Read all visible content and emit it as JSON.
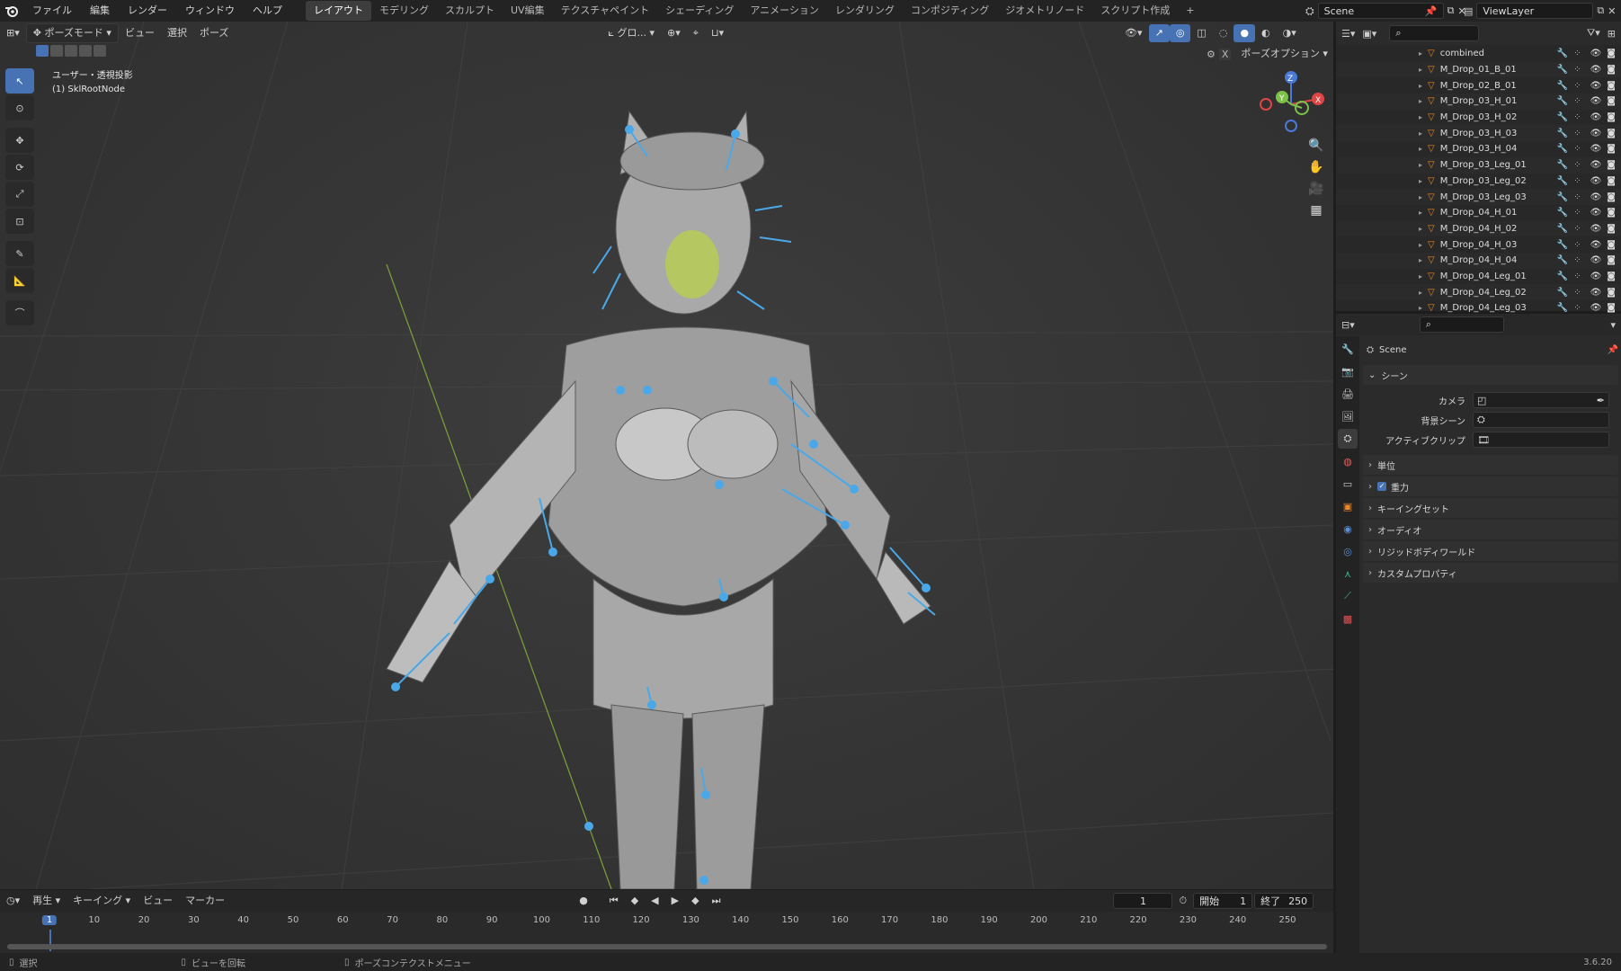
{
  "topbar": {
    "menus": [
      "ファイル",
      "編集",
      "レンダー",
      "ウィンドウ",
      "ヘルプ"
    ],
    "workspaces": [
      "レイアウト",
      "モデリング",
      "スカルプト",
      "UV編集",
      "テクスチャペイント",
      "シェーディング",
      "アニメーション",
      "レンダリング",
      "コンポジティング",
      "ジオメトリノード",
      "スクリプト作成"
    ],
    "add_tab": "+",
    "scene_name": "Scene",
    "view_layer": "ViewLayer"
  },
  "viewport": {
    "mode": "ポーズモード",
    "menus": [
      "ビュー",
      "選択",
      "ポーズ"
    ],
    "transform_orient": "グロ...",
    "pose_options": "ポーズオプション",
    "overlay_title": "ユーザー・透視投影",
    "overlay_object": "(1) SklRootNode",
    "gizmo": {
      "z": "Z",
      "y": "Y",
      "x": "X"
    }
  },
  "outliner": {
    "items": [
      {
        "name": "combined"
      },
      {
        "name": "M_Drop_01_B_01"
      },
      {
        "name": "M_Drop_02_B_01"
      },
      {
        "name": "M_Drop_03_H_01"
      },
      {
        "name": "M_Drop_03_H_02"
      },
      {
        "name": "M_Drop_03_H_03"
      },
      {
        "name": "M_Drop_03_H_04"
      },
      {
        "name": "M_Drop_03_Leg_01"
      },
      {
        "name": "M_Drop_03_Leg_02"
      },
      {
        "name": "M_Drop_03_Leg_03"
      },
      {
        "name": "M_Drop_04_H_01"
      },
      {
        "name": "M_Drop_04_H_02"
      },
      {
        "name": "M_Drop_04_H_03"
      },
      {
        "name": "M_Drop_04_H_04"
      },
      {
        "name": "M_Drop_04_Leg_01"
      },
      {
        "name": "M_Drop_04_Leg_02"
      },
      {
        "name": "M_Drop_04_Leg_03"
      }
    ]
  },
  "properties": {
    "header": "Scene",
    "panel": "シーン",
    "fields": [
      {
        "label": "カメラ"
      },
      {
        "label": "背景シーン"
      },
      {
        "label": "アクティブクリップ"
      }
    ],
    "sections": [
      "単位",
      "重力",
      "キーイングセット",
      "オーディオ",
      "リジッドボディワールド",
      "カスタムプロパティ"
    ],
    "gravity_checked": true
  },
  "timeline": {
    "menus": [
      "再生",
      "キーイング",
      "ビュー",
      "マーカー"
    ],
    "current_frame": "1",
    "start_label": "開始",
    "start": "1",
    "end_label": "終了",
    "end": "250",
    "ticks": [
      "1",
      "10",
      "20",
      "30",
      "40",
      "50",
      "60",
      "70",
      "80",
      "90",
      "100",
      "110",
      "120",
      "130",
      "140",
      "150",
      "160",
      "170",
      "180",
      "190",
      "200",
      "210",
      "220",
      "230",
      "240",
      "250"
    ]
  },
  "statusbar": {
    "select": "選択",
    "rotate": "ビューを回転",
    "context": "ポーズコンテクストメニュー",
    "version": "3.6.20"
  },
  "colors": {
    "accent": "#4772b3",
    "bone": "#4aa8e8",
    "object": "#e8892a"
  }
}
